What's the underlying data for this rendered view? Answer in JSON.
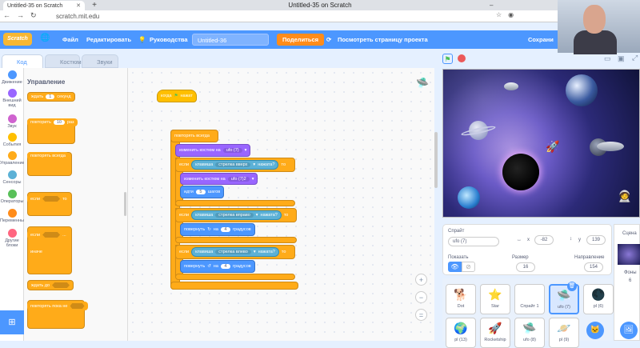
{
  "browser": {
    "tab_title": "Untitled-35 on Scratch",
    "window_title": "Untitled-35 on Scratch",
    "url": "scratch.mit.edu"
  },
  "menu": {
    "file": "Файл",
    "edit": "Редактировать",
    "tutorials": "Руководства",
    "project_title": "Untitled-36",
    "share": "Поделиться",
    "see_project": "Посмотреть страницу проекта",
    "save": "Сохрани"
  },
  "tabs": {
    "code": "Код",
    "costumes": "Костюмы",
    "sounds": "Звуки"
  },
  "categories": [
    {
      "label": "Движение",
      "color": "#4c97ff"
    },
    {
      "label": "Внешний вид",
      "color": "#9966ff"
    },
    {
      "label": "Звук",
      "color": "#cf63cf"
    },
    {
      "label": "События",
      "color": "#ffbf00"
    },
    {
      "label": "Управление",
      "color": "#ffab19"
    },
    {
      "label": "Сенсоры",
      "color": "#5cb1d6"
    },
    {
      "label": "Операторы",
      "color": "#59c059"
    },
    {
      "label": "Переменные",
      "color": "#ff8c1a"
    },
    {
      "label": "Другие блоки",
      "color": "#ff6680"
    }
  ],
  "palette": {
    "heading": "Управление",
    "wait": "ждать",
    "wait_val": "1",
    "wait_unit": "секунд",
    "repeat": "повторить",
    "repeat_val": "10",
    "repeat_unit": "раз",
    "forever": "повторять всегда",
    "if": "если",
    "then": "то",
    "else": "иначе",
    "wait_until": "ждать до",
    "repeat_until": "повторять пока не"
  },
  "script": {
    "when_flag": "когда",
    "clicked": "нажат",
    "forever": "повторять всегда",
    "switch_costume": "изменить костюм на",
    "costume_val": "ufo (7)",
    "if": "если",
    "then": "то",
    "key": "клавиша",
    "pressed": "нажата?",
    "up": "стрелка вверх",
    "right": "стрелка вправо",
    "left": "стрелка влево",
    "costume_val2": "ufo (7)2",
    "go": "идти",
    "go_val": "5",
    "steps": "шагов",
    "turn": "повернуть",
    "on": "на",
    "turn_val": "4",
    "degrees": "градусов"
  },
  "sprite_info": {
    "sprite_label": "Спрайт",
    "sprite_name": "ufo (7)",
    "x_label": "x",
    "x_val": "-82",
    "y_label": "y",
    "y_val": "139",
    "show_label": "Показать",
    "size_label": "Размер",
    "size_val": "16",
    "dir_label": "Направление",
    "dir_val": "154"
  },
  "sprites": [
    {
      "name": "Dot",
      "icon": "🐕"
    },
    {
      "name": "Star",
      "icon": "⭐"
    },
    {
      "name": "Спрайт 1",
      "icon": ""
    },
    {
      "name": "ufo (7)",
      "icon": "🛸"
    },
    {
      "name": "pl (6)",
      "icon": "🌑"
    },
    {
      "name": "pl (13)",
      "icon": "🌍"
    },
    {
      "name": "Rocketship",
      "icon": "🚀"
    },
    {
      "name": "ufo (8)",
      "icon": "🛸"
    },
    {
      "name": "pl (9)",
      "icon": "🪐"
    }
  ],
  "stage_panel": {
    "label": "Сцена",
    "backdrops_label": "Фоны",
    "backdrops_count": "6"
  }
}
